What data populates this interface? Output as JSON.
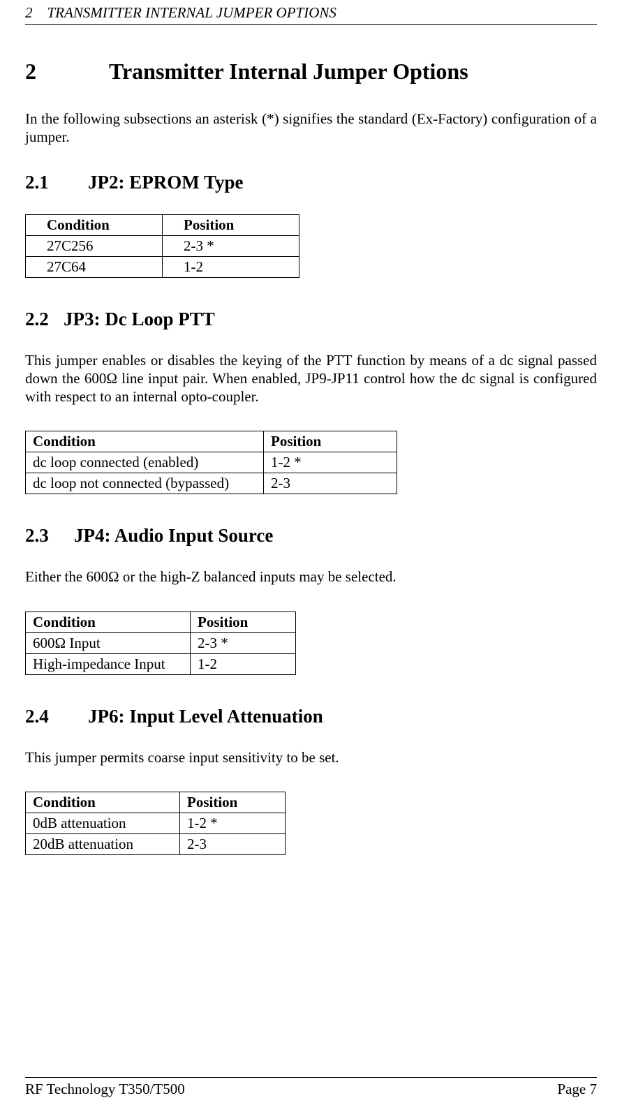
{
  "header": "2 TRANSMITTER INTERNAL JUMPER OPTIONS",
  "chapter": {
    "num": "2",
    "title": "Transmitter Internal Jumper Options"
  },
  "intro": "In the following subsections an asterisk (*) signifies the standard (Ex-Factory) configuration of a jumper.",
  "s21": {
    "num": "2.1",
    "title": "JP2: EPROM Type",
    "table": {
      "hCond": "Condition",
      "hPos": "Position",
      "r1c": "27C256",
      "r1p": "2-3 *",
      "r2c": "27C64",
      "r2p": "1-2"
    }
  },
  "s22": {
    "num": "2.2",
    "title": "JP3: Dc Loop PTT",
    "body": "This jumper enables or disables the keying of the PTT function by means of a dc signal passed down the 600Ω line input pair.  When enabled, JP9-JP11 control how the dc signal is configured with respect to an internal opto-coupler.",
    "table": {
      "hCond": "Condition",
      "hPos": "Position",
      "r1c": "dc loop connected (enabled)",
      "r1p": " 1-2 *",
      "r2c": "dc loop not connected (bypassed)",
      "r2p": " 2-3"
    }
  },
  "s23": {
    "num": "2.3",
    "title": "JP4: Audio Input Source",
    "body": "Either the 600Ω or the high-Z balanced inputs may be selected.",
    "table": {
      "hCond": "Condition",
      "hPos": "Position",
      "r1c": "600Ω Input",
      "r1p": "2-3 *",
      "r2c": "High-impedance Input",
      "r2p": "1-2"
    }
  },
  "s24": {
    "num": "2.4",
    "title": "JP6: Input Level Attenuation",
    "body": "This jumper permits coarse input sensitivity to be set.",
    "table": {
      "hCond": "Condition",
      "hPos": "Position",
      "r1c": "0dB attenuation",
      "r1p": "1-2 *",
      "r2c": "20dB attenuation",
      "r2p": "2-3"
    }
  },
  "footer": {
    "left": "RF Technology   T350/T500",
    "right": "Page 7"
  }
}
